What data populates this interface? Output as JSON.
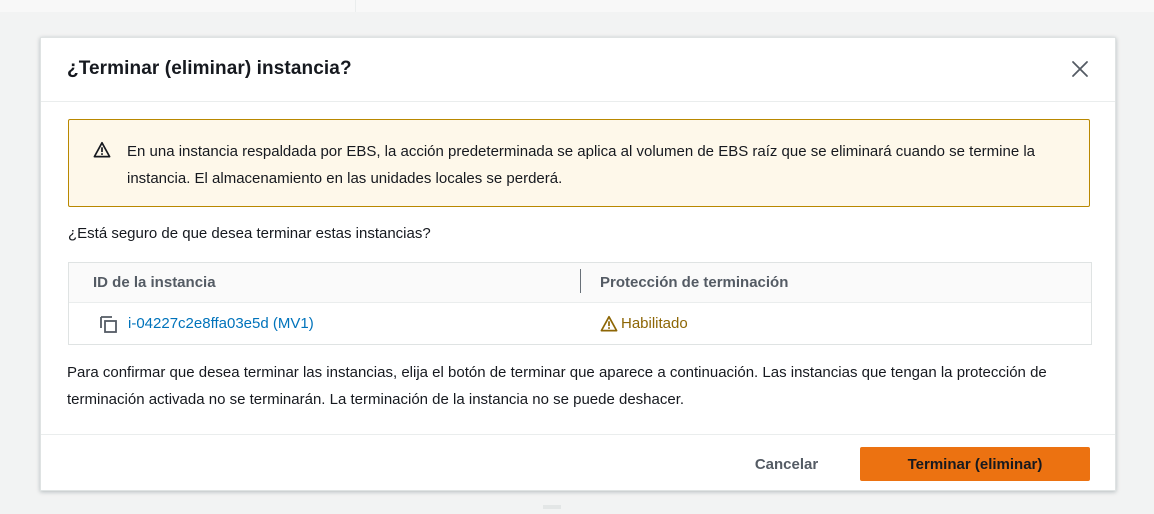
{
  "modal": {
    "title": "¿Terminar (eliminar) instancia?",
    "close_icon": "close-icon"
  },
  "alert": {
    "icon": "warning-icon",
    "text": "En una instancia respaldada por EBS, la acción predeterminada se aplica al volumen de EBS raíz que se eliminará cuando se termine la instancia. El almacenamiento en las unidades locales se perderá."
  },
  "question": "¿Está seguro de que desea terminar estas instancias?",
  "table": {
    "columns": [
      "ID de la instancia",
      "Protección de terminación"
    ],
    "rows": [
      {
        "instance_id": "i-04227c2e8ffa03e5d (MV1)",
        "copy_icon": "copy-icon",
        "protection_icon": "warning-icon",
        "protection": "Habilitado"
      }
    ]
  },
  "confirm_text": "Para confirmar que desea terminar las instancias, elija el botón de terminar que aparece a continuación. Las instancias que tengan la protección de terminación activada no se terminarán. La terminación de la instancia no se puede deshacer.",
  "footer": {
    "cancel_label": "Cancelar",
    "terminate_label": "Terminar (eliminar)"
  },
  "colors": {
    "primary_button": "#ec7211",
    "link": "#0073bb",
    "alert_background": "#fef8ea",
    "alert_border": "#b98800",
    "warning_text": "#8d6605"
  }
}
